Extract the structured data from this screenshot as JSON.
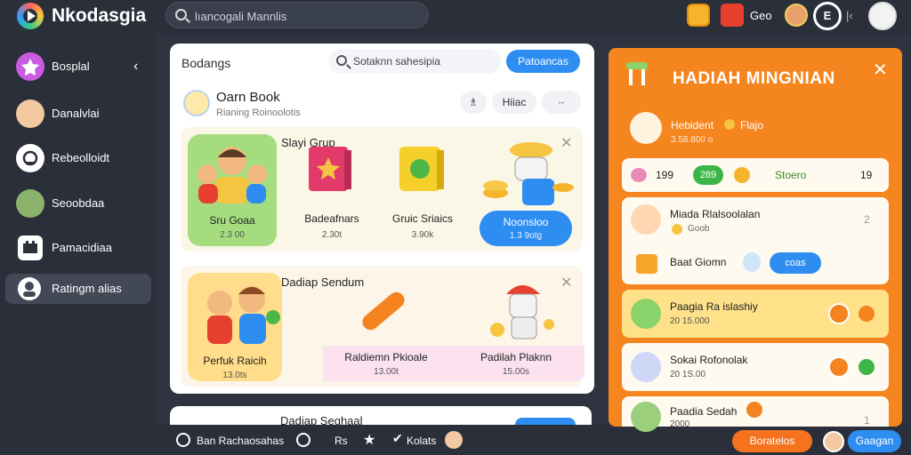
{
  "app": {
    "title": "Nkodasgia"
  },
  "search": {
    "placeholder": "lıancogali Mannlis"
  },
  "topbar": {
    "label": "Geo",
    "circle_btn": "E",
    "sep": "|‹"
  },
  "sidebar": {
    "items": [
      {
        "label": "Bosplal",
        "icon": "star-icon"
      },
      {
        "label": "Danalvlai",
        "icon": "avatar"
      },
      {
        "label": "Rebeolloidt",
        "icon": "chat-icon"
      },
      {
        "label": "Seoobdaa",
        "icon": "avatar"
      },
      {
        "label": "Pamacidiaa",
        "icon": "grid-icon"
      },
      {
        "label": "Ratingm alias",
        "icon": "user-icon"
      }
    ],
    "chevron": "‹"
  },
  "main": {
    "heading": "Bodangs",
    "search_placeholder": "Sotaknn sahesipia",
    "button": "Patoancas",
    "card_title": "Oarn Book",
    "card_subtitle": "Rianing Roinoolotis",
    "pill_user": "♗",
    "pill_label": "Hiiac",
    "pill_more": "∙∙",
    "section1": {
      "title": "Slayi Grup",
      "close": "✕",
      "tiles": [
        {
          "label": "Sru Goaa",
          "sub": "2.3 00"
        },
        {
          "label": "Badeafnars",
          "sub": "2.30t"
        },
        {
          "label": "Gruic Sriaics",
          "sub": "3.90k"
        },
        {
          "label": "Noonsloo",
          "sub": "1.3 9otg"
        }
      ]
    },
    "section2": {
      "title": "Dadiap Sendum",
      "close": "✕",
      "tiles": [
        {
          "label": "Perfuk Raicih",
          "sub": "13.0ts"
        },
        {
          "label": "Raldiemn Pkioale",
          "sub": "13.00t"
        },
        {
          "label": "Padilah Plaknn",
          "sub": "15.00s"
        }
      ]
    },
    "section3": {
      "title": "Dadiap Seghaal"
    }
  },
  "bottombar": {
    "label1": "Ban Rachaosahas",
    "label2": "Rs",
    "label3": "Kolats",
    "btn_orange": "Boratelos",
    "btn_blue": "Gaagan"
  },
  "rightpanel": {
    "title": "HADIAH MINGNIAN",
    "close": "✕",
    "top_item": {
      "title": "Hebident",
      "tag": "Flajo",
      "sub": "3.58.800 o"
    },
    "stats": {
      "a": "199",
      "b": "289",
      "c": "Stoero",
      "d": "19"
    },
    "cards": [
      {
        "title": "Miada Rlalsoolalan",
        "sub": "Goob",
        "num": "2"
      },
      {
        "title": "Baat Giomn",
        "btn": "coas"
      },
      {
        "title": "Paagia Ra islashiy",
        "sub": "20 15.000"
      },
      {
        "title": "Sokai Rofonolak",
        "sub": "20 1S.00"
      },
      {
        "title": "Paadia Sedah",
        "sub": "2000",
        "num": "1"
      }
    ]
  },
  "colors": {
    "accent": "#f5851f",
    "blue": "#2e8df0",
    "bg": "#2b2f3a"
  }
}
